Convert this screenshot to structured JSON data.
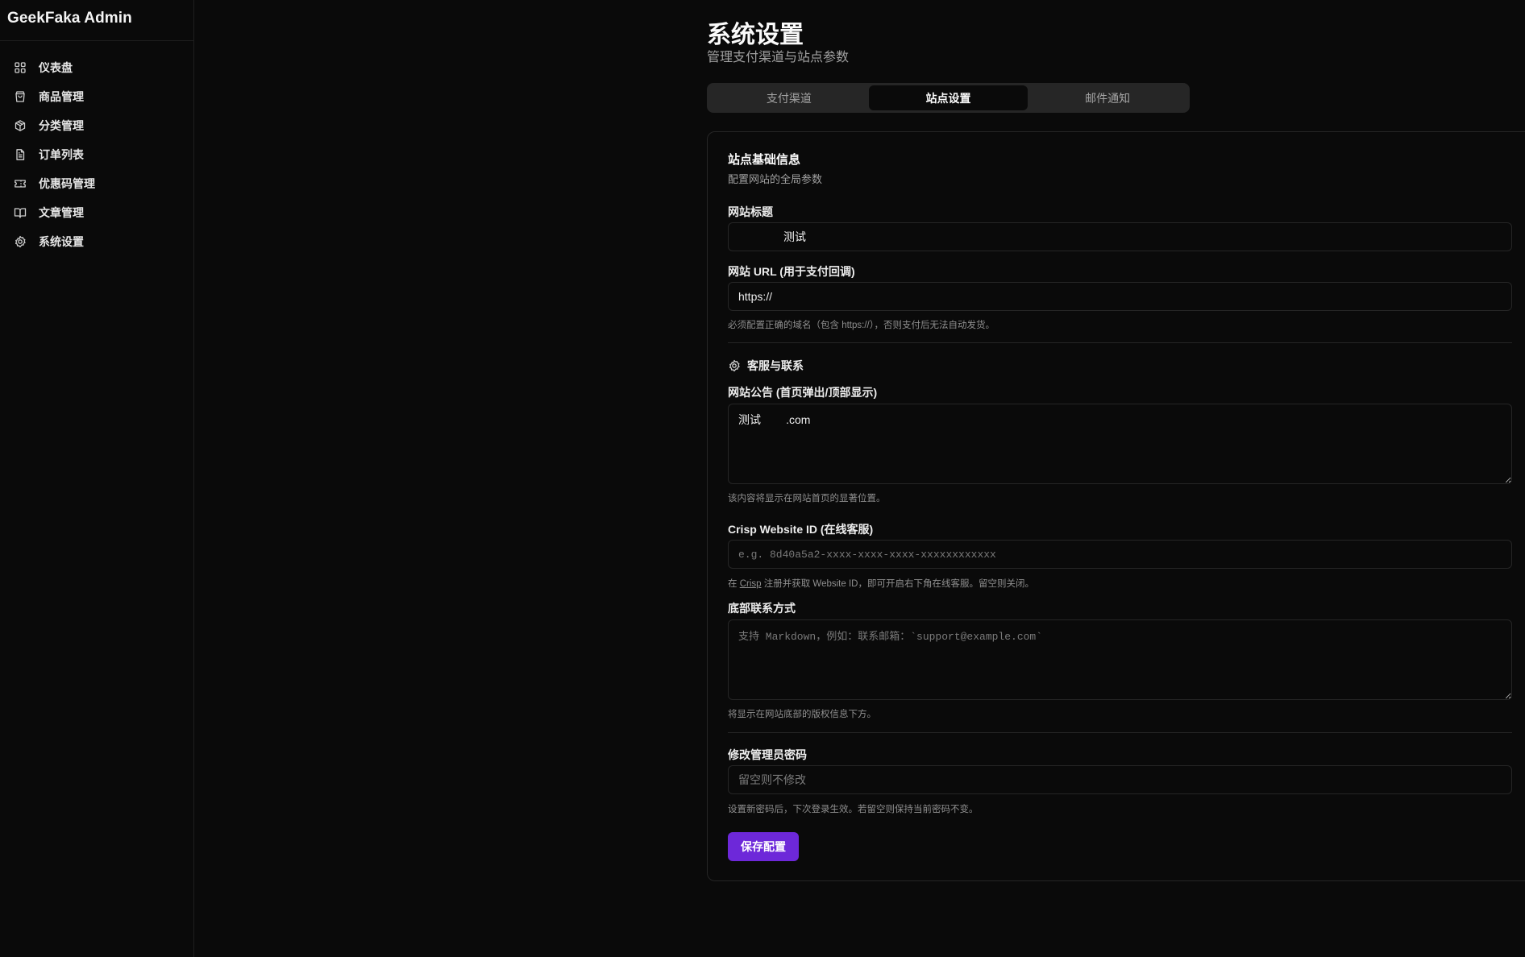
{
  "app": {
    "brand": "GeekFaka Admin"
  },
  "sidebar": {
    "items": [
      {
        "label": "仪表盘",
        "icon": "dashboard-icon"
      },
      {
        "label": "商品管理",
        "icon": "shopping-bag-icon"
      },
      {
        "label": "分类管理",
        "icon": "package-icon"
      },
      {
        "label": "订单列表",
        "icon": "file-text-icon"
      },
      {
        "label": "优惠码管理",
        "icon": "ticket-icon"
      },
      {
        "label": "文章管理",
        "icon": "book-open-icon"
      },
      {
        "label": "系统设置",
        "icon": "settings-icon"
      }
    ]
  },
  "page": {
    "title": "系统设置",
    "subtitle": "管理支付渠道与站点参数"
  },
  "tabs": {
    "items": [
      "支付渠道",
      "站点设置",
      "邮件通知"
    ],
    "active": "站点设置"
  },
  "card": {
    "title": "站点基础信息",
    "description": "配置网站的全局参数",
    "site_title": {
      "label": "网站标题",
      "value": "测试"
    },
    "site_url": {
      "label": "网站 URL (用于支付回调)",
      "value": "https://",
      "hint": "必须配置正确的域名（包含 https://），否则支付后无法自动发货。"
    },
    "support_section": {
      "title": "客服与联系",
      "icon": "settings-icon"
    },
    "announcement": {
      "label": "网站公告 (首页弹出/顶部显示)",
      "value": "测试        .com",
      "hint": "该内容将显示在网站首页的显著位置。"
    },
    "crisp": {
      "label": "Crisp Website ID (在线客服)",
      "placeholder": "e.g. 8d40a5a2-xxxx-xxxx-xxxx-xxxxxxxxxxxx",
      "hint_prefix": "在 ",
      "hint_link": "Crisp",
      "hint_suffix": " 注册并获取 Website ID，即可开启右下角在线客服。留空则关闭。"
    },
    "footer_contact": {
      "label": "底部联系方式",
      "placeholder": "支持 Markdown，例如：联系邮箱：`support@example.com`",
      "hint": "将显示在网站底部的版权信息下方。"
    },
    "admin_password": {
      "label": "修改管理员密码",
      "placeholder": "留空则不修改",
      "hint": "设置新密码后，下次登录生效。若留空则保持当前密码不变。"
    },
    "save_label": "保存配置"
  },
  "colors": {
    "background": "#0a0a0a",
    "accent": "#6d28d9",
    "border": "#262626"
  }
}
